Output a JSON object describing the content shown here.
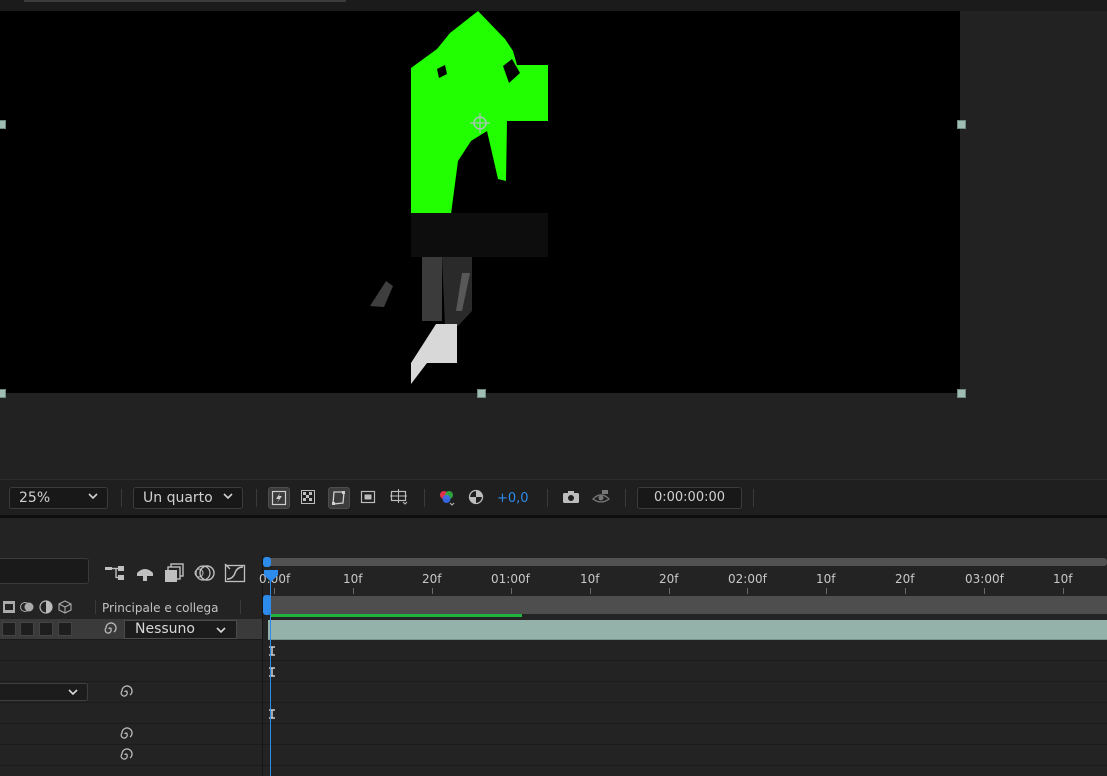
{
  "viewer": {
    "zoom_value": "25%",
    "resolution_value": "Un quarto",
    "exposure_value": "+0,0",
    "timecode": "0:00:00:00"
  },
  "timeline": {
    "column_header": "Principale e collega",
    "parent_value": "Nessuno",
    "ruler_labels": [
      "0:00f",
      "10f",
      "20f",
      "01:00f",
      "10f",
      "20f",
      "02:00f",
      "10f",
      "20f",
      "03:00f",
      "10f"
    ],
    "render_progress": 0.3
  },
  "colors": {
    "accent": "#2d8ceb",
    "layer_bar": "#94b2aa",
    "render_bar": "#20b43c",
    "key_green": "#22ff00"
  },
  "icons": [
    "zoom-chevron-icon",
    "fast-previews-icon",
    "transparency-grid-icon",
    "mask-visibility-icon",
    "region-of-interest-icon",
    "guides-icon",
    "channel-icon",
    "exposure-reset-icon",
    "snapshot-icon",
    "show-snapshot-icon",
    "comp-flowchart-icon",
    "draft-3d-icon",
    "frame-blending-icon",
    "motion-blur-icon",
    "graph-editor-icon",
    "pick-whip-icon"
  ]
}
